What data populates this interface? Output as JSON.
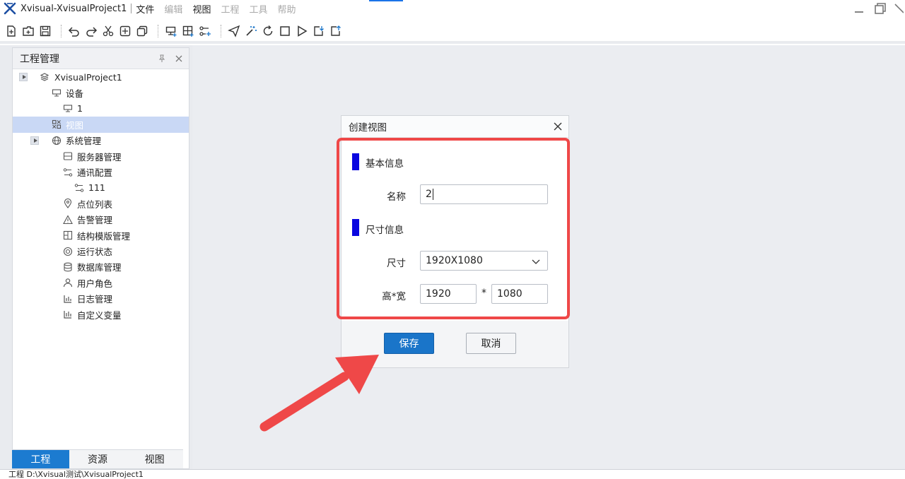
{
  "window": {
    "title": "Xvisual-XvisualProject1",
    "menu": [
      {
        "label": "文件",
        "enabled": true
      },
      {
        "label": "编辑",
        "enabled": false
      },
      {
        "label": "视图",
        "enabled": true
      },
      {
        "label": "工程",
        "enabled": false
      },
      {
        "label": "工具",
        "enabled": false
      },
      {
        "label": "帮助",
        "enabled": false
      }
    ]
  },
  "toolbar": {
    "icons": [
      "new-file-icon",
      "open-folder-icon",
      "save-icon",
      "undo-icon",
      "redo-icon",
      "cut-icon",
      "copy-add-icon",
      "paste-icon",
      "device-add-icon",
      "grid-add-icon",
      "link-add-icon",
      "send-icon",
      "magic-icon",
      "refresh-icon",
      "stop-icon",
      "play-icon",
      "export-icon",
      "import-icon"
    ]
  },
  "project_panel": {
    "title": "工程管理",
    "tree": [
      {
        "label": "XvisualProject1",
        "icon": "layers-icon",
        "expander": true
      },
      {
        "label": "设备",
        "icon": "device-icon"
      },
      {
        "label": "1",
        "icon": "device-icon"
      },
      {
        "label": "视图",
        "icon": "view-icon",
        "selected": true
      },
      {
        "label": "系统管理",
        "icon": "globe-icon",
        "expander": true
      },
      {
        "label": "服务器管理",
        "icon": "server-icon"
      },
      {
        "label": "通讯配置",
        "icon": "comm-icon"
      },
      {
        "label": "111",
        "icon": "comm-icon"
      },
      {
        "label": "点位列表",
        "icon": "location-icon"
      },
      {
        "label": "告警管理",
        "icon": "warning-icon"
      },
      {
        "label": "结构模版管理",
        "icon": "structure-icon"
      },
      {
        "label": "运行状态",
        "icon": "status-icon"
      },
      {
        "label": "数据库管理",
        "icon": "database-icon"
      },
      {
        "label": "用户角色",
        "icon": "user-icon"
      },
      {
        "label": "日志管理",
        "icon": "log-icon"
      },
      {
        "label": "自定义变量",
        "icon": "variable-icon"
      }
    ],
    "tabs": [
      {
        "label": "工程",
        "active": true
      },
      {
        "label": "资源",
        "active": false
      },
      {
        "label": "视图",
        "active": false
      }
    ]
  },
  "status_bar": {
    "text": "工程  D:\\Xvisual测试\\XvisualProject1"
  },
  "dialog": {
    "title": "创建视图",
    "section_basic": "基本信息",
    "name_label": "名称",
    "name_value": "2",
    "section_size": "尺寸信息",
    "size_label": "尺寸",
    "size_value": "1920X1080",
    "hw_label": "高*宽",
    "height_value": "1920",
    "times": "*",
    "width_value": "1080",
    "save_label": "保存",
    "cancel_label": "取消"
  },
  "colors": {
    "accent": "#1a75c9",
    "highlight": "#ef4848",
    "section_marker": "#0a06e0",
    "tree_selected": "#c9d8f5"
  }
}
